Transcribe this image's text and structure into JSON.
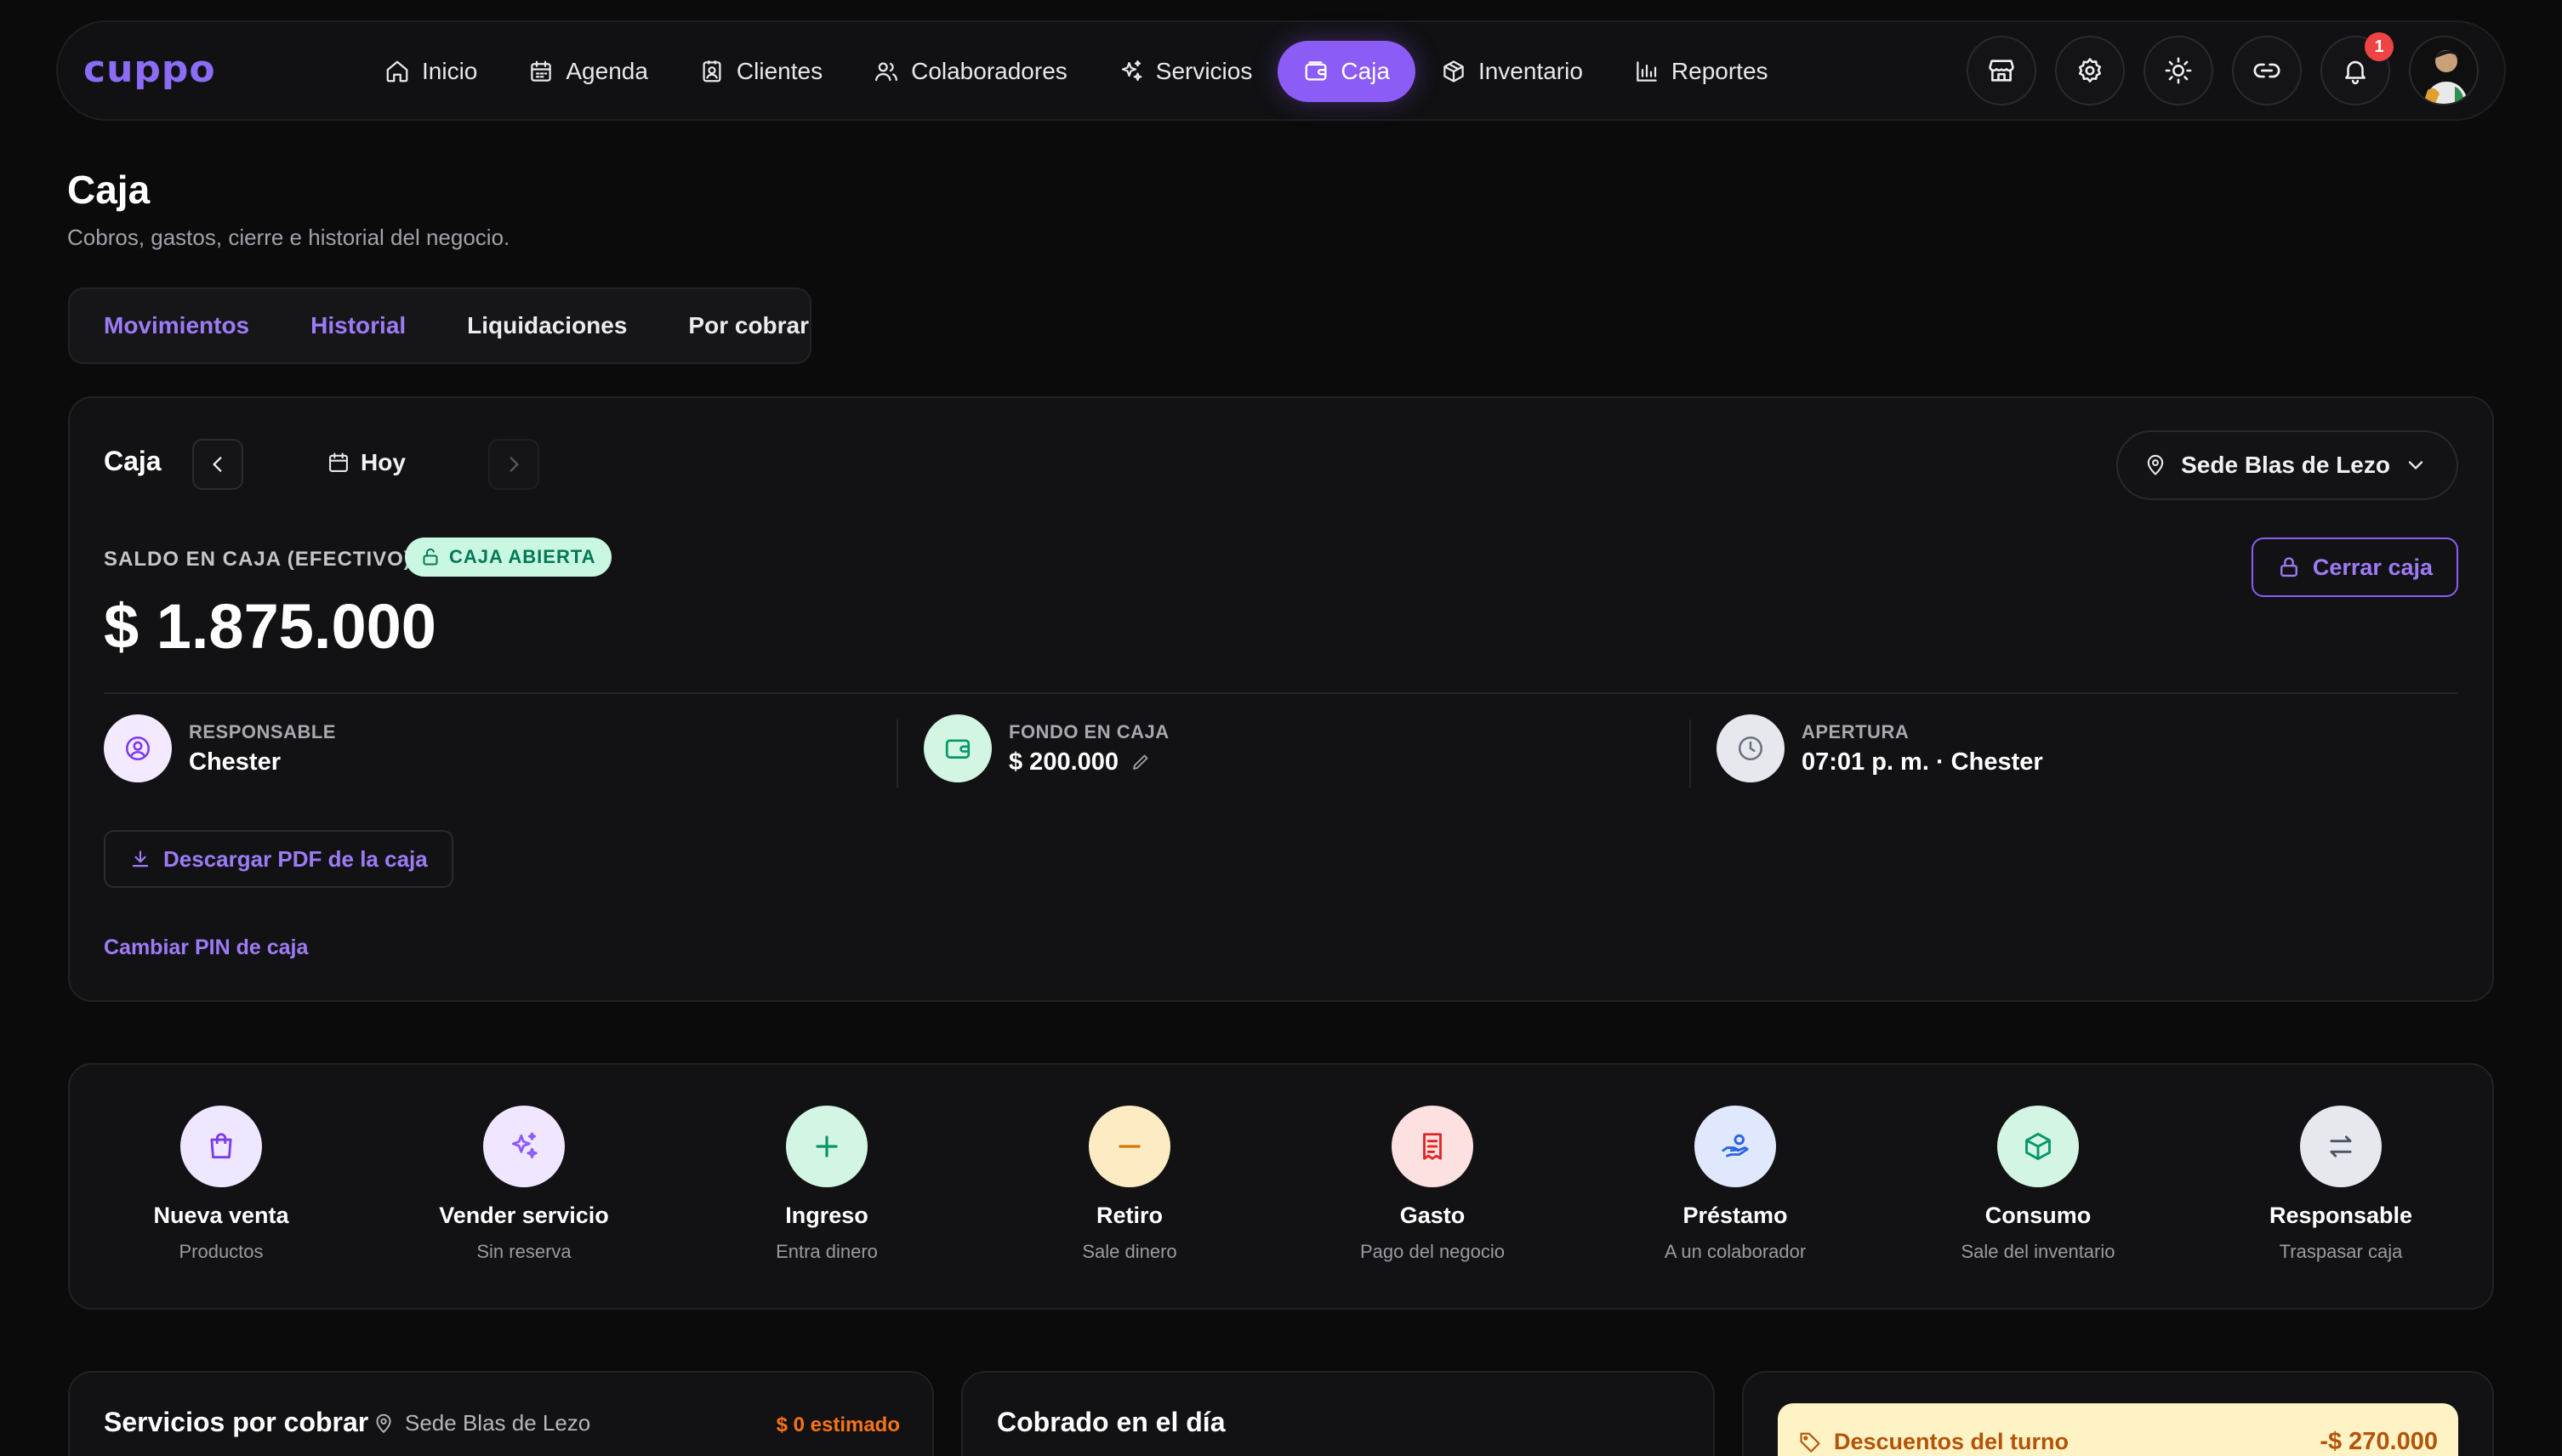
{
  "brand": {
    "logo": "cuppo",
    "accent": "#8b5cf6"
  },
  "nav": {
    "items": [
      {
        "label": "Inicio",
        "icon": "home-icon"
      },
      {
        "label": "Agenda",
        "icon": "calendar-icon"
      },
      {
        "label": "Clientes",
        "icon": "contact-icon"
      },
      {
        "label": "Colaboradores",
        "icon": "users-icon"
      },
      {
        "label": "Servicios",
        "icon": "sparkles-icon"
      },
      {
        "label": "Caja",
        "icon": "wallet-icon",
        "active": true
      },
      {
        "label": "Inventario",
        "icon": "box-icon"
      },
      {
        "label": "Reportes",
        "icon": "bar-chart-icon"
      }
    ],
    "notifications_count": "1"
  },
  "header": {
    "title": "Caja",
    "subtitle": "Cobros, gastos, cierre e historial del negocio."
  },
  "tabs": [
    "Movimientos",
    "Historial",
    "Liquidaciones",
    "Por cobrar"
  ],
  "caja": {
    "label": "Caja",
    "date": "Hoy",
    "sede": "Sede Blas de Lezo",
    "saldo_label": "SALDO EN CAJA (EFECTIVO)",
    "status": "CAJA ABIERTA",
    "saldo": "$ 1.875.000",
    "cerrar_label": "Cerrar caja",
    "responsable_label": "RESPONSABLE",
    "responsable": "Chester",
    "fondo_label": "FONDO EN CAJA",
    "fondo": "$ 200.000",
    "apertura_label": "APERTURA",
    "apertura": "07:01 p. m. · Chester",
    "pdf_label": "Descargar PDF de la caja",
    "pin_label": "Cambiar PIN de caja"
  },
  "actions": [
    {
      "title": "Nueva venta",
      "sub": "Productos",
      "icon": "shopping-bag-icon",
      "bg": "#efe7ff",
      "fg": "#7c3aed"
    },
    {
      "title": "Vender servicio",
      "sub": "Sin reserva",
      "icon": "sparkles-icon",
      "bg": "#f1e6ff",
      "fg": "#8b5cf6"
    },
    {
      "title": "Ingreso",
      "sub": "Entra dinero",
      "icon": "plus-icon",
      "bg": "#d3f5e4",
      "fg": "#059669"
    },
    {
      "title": "Retiro",
      "sub": "Sale dinero",
      "icon": "minus-icon",
      "bg": "#fdecc3",
      "fg": "#d97706"
    },
    {
      "title": "Gasto",
      "sub": "Pago del negocio",
      "icon": "receipt-icon",
      "bg": "#fde0e0",
      "fg": "#dc2626"
    },
    {
      "title": "Préstamo",
      "sub": "A un colaborador",
      "icon": "hand-coins-icon",
      "bg": "#e0e8fd",
      "fg": "#2563eb"
    },
    {
      "title": "Consumo",
      "sub": "Sale del inventario",
      "icon": "package-icon",
      "bg": "#d3f5e4",
      "fg": "#059669"
    },
    {
      "title": "Responsable",
      "sub": "Traspasar caja",
      "icon": "transfer-icon",
      "bg": "#e6e8ee",
      "fg": "#4b5563"
    }
  ],
  "bottom": {
    "servicios_title": "Servicios por cobrar",
    "servicios_sede": "Sede Blas de Lezo",
    "servicios_estimado": "$ 0 estimado",
    "cobrado_title": "Cobrado en el día",
    "descuentos_label": "Descuentos del turno",
    "descuentos_value": "-$ 270.000"
  }
}
